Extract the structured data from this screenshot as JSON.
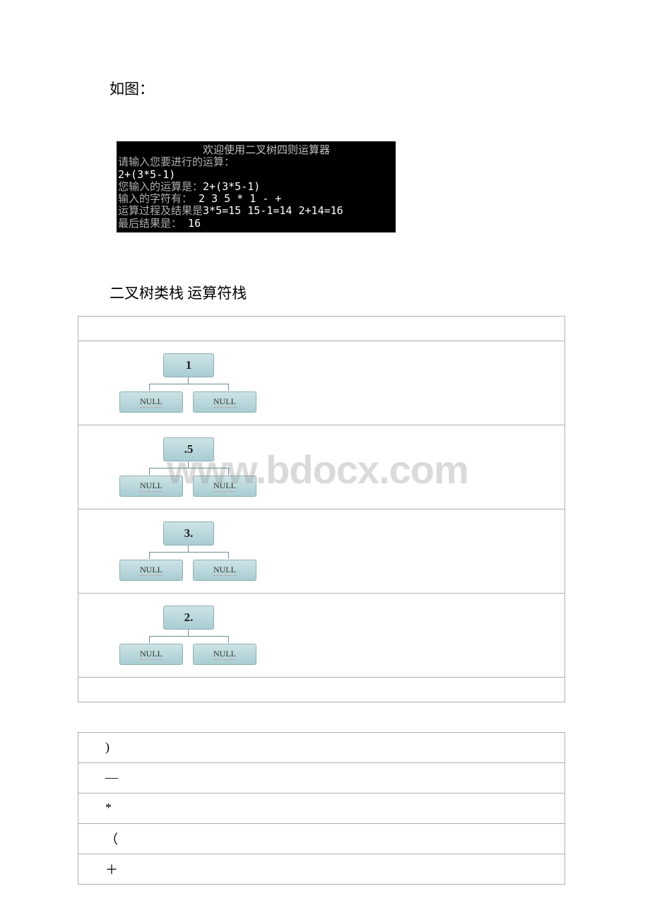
{
  "intro": "如图：",
  "console": {
    "title": "欢迎使用二叉树四则运算器",
    "prompt": " 请输入您要进行的运算：",
    "input": "2+(3*5-1)",
    "echo_label": "您输入的运算是：",
    "echo_value": "2+(3*5-1)",
    "chars_label": "输入的字符有： ",
    "chars_value": "2 3 5 * 1 - +",
    "process_label": "运算过程及结果是",
    "process_value": "3*5=15  15-1=14 2+14=16",
    "result_label": "最后结果是： ",
    "result_value": "16"
  },
  "h2": "二叉树类栈 运算符栈",
  "trees": [
    {
      "root": "1",
      "left": "NULL",
      "right": "NULL"
    },
    {
      "root": ".5",
      "left": "NULL",
      "right": "NULL"
    },
    {
      "root": "3.",
      "left": "NULL",
      "right": "NULL"
    },
    {
      "root": "2.",
      "left": "NULL",
      "right": "NULL"
    }
  ],
  "watermark": "www.bdocx.com",
  "operators": [
    ")",
    "—",
    "*",
    "（",
    "＋"
  ]
}
